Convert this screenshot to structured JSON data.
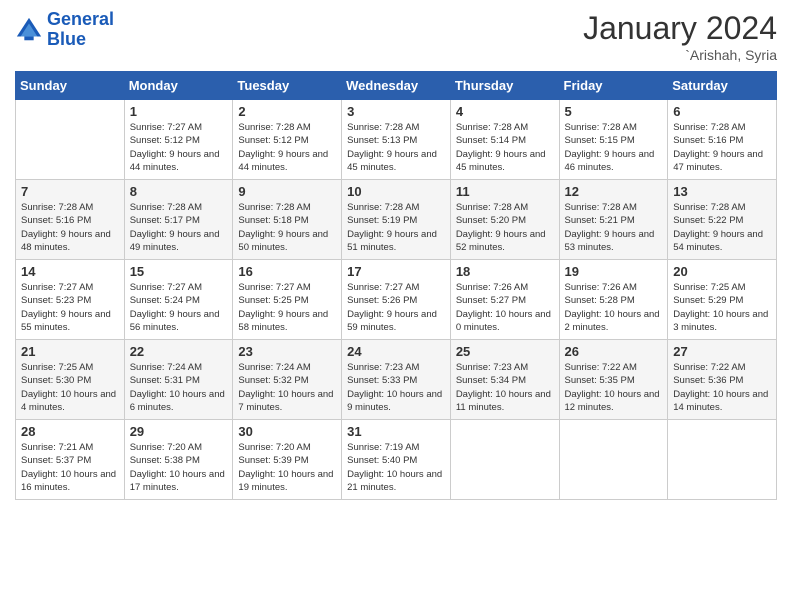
{
  "logo": {
    "line1": "General",
    "line2": "Blue"
  },
  "title": "January 2024",
  "location": "`Arishah, Syria",
  "days_header": [
    "Sunday",
    "Monday",
    "Tuesday",
    "Wednesday",
    "Thursday",
    "Friday",
    "Saturday"
  ],
  "weeks": [
    [
      {
        "day": "",
        "sunrise": "",
        "sunset": "",
        "daylight": ""
      },
      {
        "day": "1",
        "sunrise": "Sunrise: 7:27 AM",
        "sunset": "Sunset: 5:12 PM",
        "daylight": "Daylight: 9 hours and 44 minutes."
      },
      {
        "day": "2",
        "sunrise": "Sunrise: 7:28 AM",
        "sunset": "Sunset: 5:12 PM",
        "daylight": "Daylight: 9 hours and 44 minutes."
      },
      {
        "day": "3",
        "sunrise": "Sunrise: 7:28 AM",
        "sunset": "Sunset: 5:13 PM",
        "daylight": "Daylight: 9 hours and 45 minutes."
      },
      {
        "day": "4",
        "sunrise": "Sunrise: 7:28 AM",
        "sunset": "Sunset: 5:14 PM",
        "daylight": "Daylight: 9 hours and 45 minutes."
      },
      {
        "day": "5",
        "sunrise": "Sunrise: 7:28 AM",
        "sunset": "Sunset: 5:15 PM",
        "daylight": "Daylight: 9 hours and 46 minutes."
      },
      {
        "day": "6",
        "sunrise": "Sunrise: 7:28 AM",
        "sunset": "Sunset: 5:16 PM",
        "daylight": "Daylight: 9 hours and 47 minutes."
      }
    ],
    [
      {
        "day": "7",
        "sunrise": "Sunrise: 7:28 AM",
        "sunset": "Sunset: 5:16 PM",
        "daylight": "Daylight: 9 hours and 48 minutes."
      },
      {
        "day": "8",
        "sunrise": "Sunrise: 7:28 AM",
        "sunset": "Sunset: 5:17 PM",
        "daylight": "Daylight: 9 hours and 49 minutes."
      },
      {
        "day": "9",
        "sunrise": "Sunrise: 7:28 AM",
        "sunset": "Sunset: 5:18 PM",
        "daylight": "Daylight: 9 hours and 50 minutes."
      },
      {
        "day": "10",
        "sunrise": "Sunrise: 7:28 AM",
        "sunset": "Sunset: 5:19 PM",
        "daylight": "Daylight: 9 hours and 51 minutes."
      },
      {
        "day": "11",
        "sunrise": "Sunrise: 7:28 AM",
        "sunset": "Sunset: 5:20 PM",
        "daylight": "Daylight: 9 hours and 52 minutes."
      },
      {
        "day": "12",
        "sunrise": "Sunrise: 7:28 AM",
        "sunset": "Sunset: 5:21 PM",
        "daylight": "Daylight: 9 hours and 53 minutes."
      },
      {
        "day": "13",
        "sunrise": "Sunrise: 7:28 AM",
        "sunset": "Sunset: 5:22 PM",
        "daylight": "Daylight: 9 hours and 54 minutes."
      }
    ],
    [
      {
        "day": "14",
        "sunrise": "Sunrise: 7:27 AM",
        "sunset": "Sunset: 5:23 PM",
        "daylight": "Daylight: 9 hours and 55 minutes."
      },
      {
        "day": "15",
        "sunrise": "Sunrise: 7:27 AM",
        "sunset": "Sunset: 5:24 PM",
        "daylight": "Daylight: 9 hours and 56 minutes."
      },
      {
        "day": "16",
        "sunrise": "Sunrise: 7:27 AM",
        "sunset": "Sunset: 5:25 PM",
        "daylight": "Daylight: 9 hours and 58 minutes."
      },
      {
        "day": "17",
        "sunrise": "Sunrise: 7:27 AM",
        "sunset": "Sunset: 5:26 PM",
        "daylight": "Daylight: 9 hours and 59 minutes."
      },
      {
        "day": "18",
        "sunrise": "Sunrise: 7:26 AM",
        "sunset": "Sunset: 5:27 PM",
        "daylight": "Daylight: 10 hours and 0 minutes."
      },
      {
        "day": "19",
        "sunrise": "Sunrise: 7:26 AM",
        "sunset": "Sunset: 5:28 PM",
        "daylight": "Daylight: 10 hours and 2 minutes."
      },
      {
        "day": "20",
        "sunrise": "Sunrise: 7:25 AM",
        "sunset": "Sunset: 5:29 PM",
        "daylight": "Daylight: 10 hours and 3 minutes."
      }
    ],
    [
      {
        "day": "21",
        "sunrise": "Sunrise: 7:25 AM",
        "sunset": "Sunset: 5:30 PM",
        "daylight": "Daylight: 10 hours and 4 minutes."
      },
      {
        "day": "22",
        "sunrise": "Sunrise: 7:24 AM",
        "sunset": "Sunset: 5:31 PM",
        "daylight": "Daylight: 10 hours and 6 minutes."
      },
      {
        "day": "23",
        "sunrise": "Sunrise: 7:24 AM",
        "sunset": "Sunset: 5:32 PM",
        "daylight": "Daylight: 10 hours and 7 minutes."
      },
      {
        "day": "24",
        "sunrise": "Sunrise: 7:23 AM",
        "sunset": "Sunset: 5:33 PM",
        "daylight": "Daylight: 10 hours and 9 minutes."
      },
      {
        "day": "25",
        "sunrise": "Sunrise: 7:23 AM",
        "sunset": "Sunset: 5:34 PM",
        "daylight": "Daylight: 10 hours and 11 minutes."
      },
      {
        "day": "26",
        "sunrise": "Sunrise: 7:22 AM",
        "sunset": "Sunset: 5:35 PM",
        "daylight": "Daylight: 10 hours and 12 minutes."
      },
      {
        "day": "27",
        "sunrise": "Sunrise: 7:22 AM",
        "sunset": "Sunset: 5:36 PM",
        "daylight": "Daylight: 10 hours and 14 minutes."
      }
    ],
    [
      {
        "day": "28",
        "sunrise": "Sunrise: 7:21 AM",
        "sunset": "Sunset: 5:37 PM",
        "daylight": "Daylight: 10 hours and 16 minutes."
      },
      {
        "day": "29",
        "sunrise": "Sunrise: 7:20 AM",
        "sunset": "Sunset: 5:38 PM",
        "daylight": "Daylight: 10 hours and 17 minutes."
      },
      {
        "day": "30",
        "sunrise": "Sunrise: 7:20 AM",
        "sunset": "Sunset: 5:39 PM",
        "daylight": "Daylight: 10 hours and 19 minutes."
      },
      {
        "day": "31",
        "sunrise": "Sunrise: 7:19 AM",
        "sunset": "Sunset: 5:40 PM",
        "daylight": "Daylight: 10 hours and 21 minutes."
      },
      {
        "day": "",
        "sunrise": "",
        "sunset": "",
        "daylight": ""
      },
      {
        "day": "",
        "sunrise": "",
        "sunset": "",
        "daylight": ""
      },
      {
        "day": "",
        "sunrise": "",
        "sunset": "",
        "daylight": ""
      }
    ]
  ]
}
